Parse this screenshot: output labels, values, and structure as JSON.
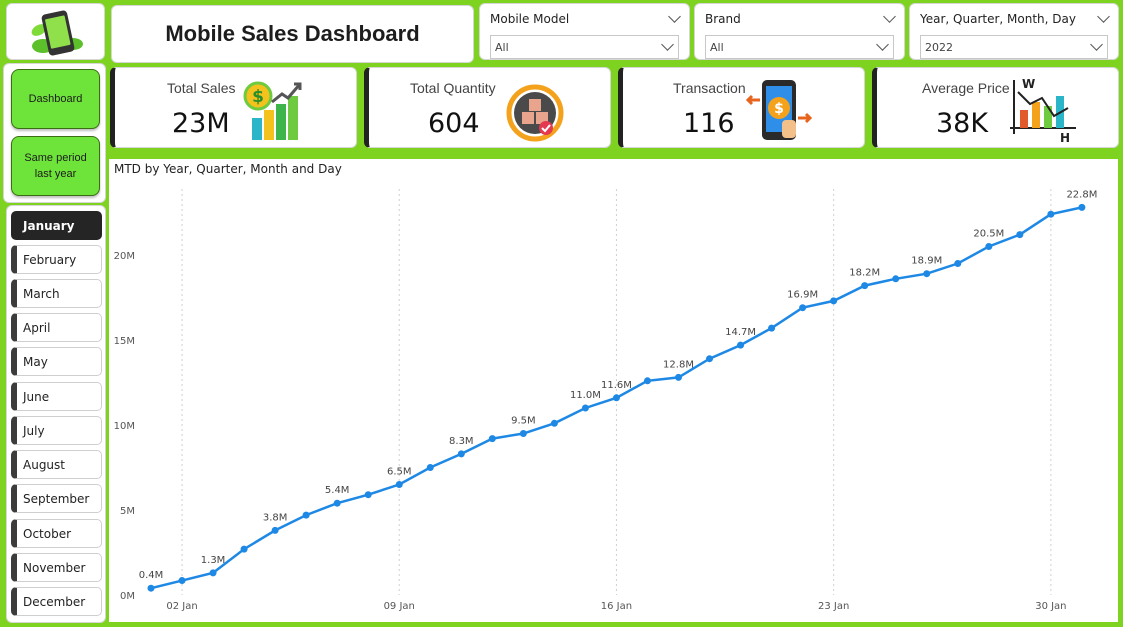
{
  "header": {
    "title": "Mobile Sales Dashboard"
  },
  "slicers": {
    "model": {
      "label": "Mobile Model",
      "value": "All"
    },
    "brand": {
      "label": "Brand",
      "value": "All"
    },
    "date": {
      "label": "Year, Quarter, Month, Day",
      "value": "2022"
    }
  },
  "nav": {
    "dashboard": "Dashboard",
    "same_period": "Same period last year"
  },
  "months": [
    "January",
    "February",
    "March",
    "April",
    "May",
    "June",
    "July",
    "August",
    "September",
    "October",
    "November",
    "December"
  ],
  "active_month": "January",
  "kpis": {
    "sales": {
      "label": "Total Sales",
      "value": "23M",
      "icon": "money-growth-icon"
    },
    "quantity": {
      "label": "Total Quantity",
      "value": "604",
      "icon": "boxes-icon"
    },
    "transaction": {
      "label": "Transaction",
      "value": "116",
      "icon": "phone-payment-icon"
    },
    "avg_price": {
      "label": "Average Price",
      "value": "38K",
      "icon": "chart-analysis-icon"
    }
  },
  "colors": {
    "background": "#7ed321",
    "line": "#1e88e5",
    "active_month": "#252525",
    "nav_button": "#6ee33a"
  },
  "chart_data": {
    "type": "line",
    "title": "MTD by Year, Quarter, Month and Day",
    "xlabel": "",
    "ylabel": "",
    "ylim": [
      0,
      25000000
    ],
    "y_ticks": [
      "0M",
      "5M",
      "10M",
      "15M",
      "20M"
    ],
    "x_ticks": [
      "02 Jan",
      "09 Jan",
      "16 Jan",
      "23 Jan",
      "30 Jan"
    ],
    "grid": "vertical dotted",
    "x": [
      1,
      2,
      3,
      4,
      5,
      6,
      7,
      8,
      9,
      10,
      11,
      12,
      13,
      14,
      15,
      16,
      17,
      18,
      19,
      20,
      21,
      22,
      23,
      24,
      25,
      26,
      27,
      28,
      29,
      30,
      31
    ],
    "values": [
      0.4,
      0.85,
      1.3,
      2.7,
      3.8,
      4.7,
      5.4,
      5.9,
      6.5,
      7.5,
      8.3,
      9.2,
      9.5,
      10.1,
      11.0,
      11.6,
      12.6,
      12.8,
      13.9,
      14.7,
      15.7,
      16.9,
      17.3,
      18.2,
      18.6,
      18.9,
      19.5,
      20.5,
      21.2,
      22.4,
      22.8
    ],
    "data_labels": [
      {
        "x": 1,
        "label": "0.4M"
      },
      {
        "x": 3,
        "label": "1.3M"
      },
      {
        "x": 5,
        "label": "3.8M"
      },
      {
        "x": 7,
        "label": "5.4M"
      },
      {
        "x": 9,
        "label": "6.5M"
      },
      {
        "x": 11,
        "label": "8.3M"
      },
      {
        "x": 13,
        "label": "9.5M"
      },
      {
        "x": 15,
        "label": "11.0M"
      },
      {
        "x": 16,
        "label": "11.6M"
      },
      {
        "x": 18,
        "label": "12.8M"
      },
      {
        "x": 20,
        "label": "14.7M"
      },
      {
        "x": 22,
        "label": "16.9M"
      },
      {
        "x": 24,
        "label": "18.2M"
      },
      {
        "x": 26,
        "label": "18.9M"
      },
      {
        "x": 28,
        "label": "20.5M"
      },
      {
        "x": 31,
        "label": "22.8M"
      }
    ]
  }
}
